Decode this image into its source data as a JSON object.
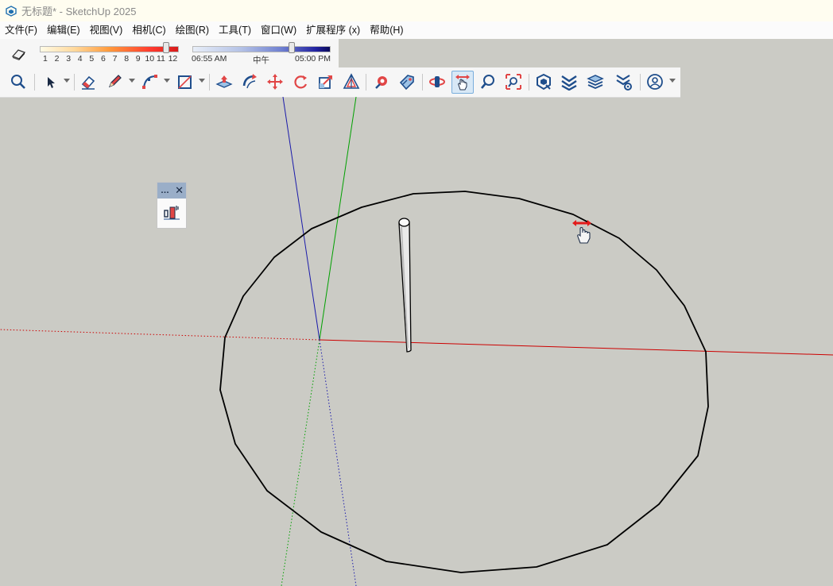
{
  "window": {
    "title": "无标题* - SketchUp 2025"
  },
  "menu": [
    "文件(F)",
    "编辑(E)",
    "视图(V)",
    "相机(C)",
    "绘图(R)",
    "工具(T)",
    "窗口(W)",
    "扩展程序 (x)",
    "帮助(H)"
  ],
  "shadows": {
    "month_ticks": [
      "1",
      "2",
      "3",
      "4",
      "5",
      "6",
      "7",
      "8",
      "9",
      "10",
      "11",
      "12"
    ],
    "month_value": 11,
    "time_start": "06:55 AM",
    "time_mid": "中午",
    "time_end": "05:00 PM",
    "time_value": 0.72
  },
  "toolbar": {
    "tools": [
      "zoom-extents-icon",
      "select-icon",
      "eraser-icon",
      "pencil-icon",
      "arc-icon",
      "rectangle-icon",
      "push-pull-icon",
      "follow-me-icon",
      "move-icon",
      "rotate-icon",
      "scale-icon",
      "offset-icon",
      "paint-bucket-icon",
      "tag-icon",
      "orbit-icon",
      "pan-icon",
      "zoom-icon",
      "zoom-window-icon",
      "warehouse-icon",
      "extension-warehouse-icon",
      "layout-icon",
      "extension-manager-icon",
      "account-icon"
    ],
    "active": "pan-icon"
  },
  "floating_panel": {
    "tool": "sandbox-tool-icon"
  },
  "colors": {
    "x_axis": "#cc0000",
    "y_axis": "#00a000",
    "z_axis": "#1a1aaa",
    "background": "#cbcbc5",
    "geometry": "#000000"
  }
}
